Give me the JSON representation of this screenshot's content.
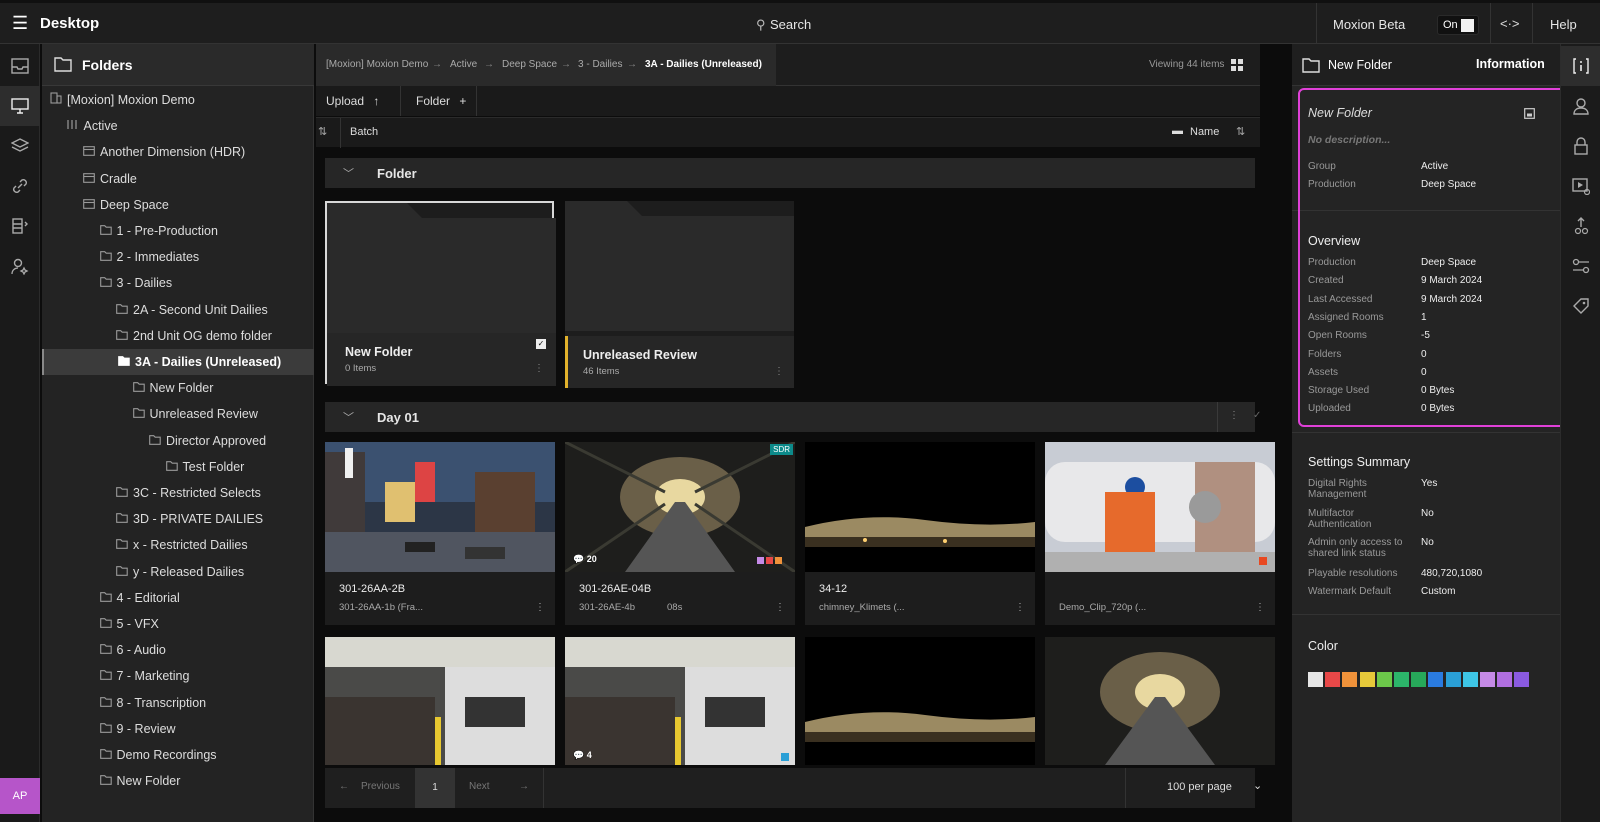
{
  "topbar": {
    "title": "Desktop",
    "search": "Search",
    "beta": "Moxion Beta",
    "toggle": "On",
    "help": "Help"
  },
  "tree": {
    "title": "Folders",
    "items": [
      {
        "label": "[Moxion] Moxion Demo",
        "level": 0,
        "icon": "building-icon"
      },
      {
        "label": "Active",
        "level": 1,
        "icon": "columns-icon"
      },
      {
        "label": "Another Dimension (HDR)",
        "level": 2,
        "icon": "production-icon"
      },
      {
        "label": "Cradle",
        "level": 2,
        "icon": "production-icon"
      },
      {
        "label": "Deep Space",
        "level": 2,
        "icon": "production-icon"
      },
      {
        "label": "1 - Pre-Production",
        "level": 3,
        "icon": "folder-icon"
      },
      {
        "label": "2 - Immediates",
        "level": 3,
        "icon": "folder-icon"
      },
      {
        "label": "3 - Dailies",
        "level": 3,
        "icon": "folder-icon"
      },
      {
        "label": "2A - Second Unit Dailies",
        "level": 4,
        "icon": "folder-icon"
      },
      {
        "label": "2nd Unit OG demo folder",
        "level": 4,
        "icon": "folder-icon"
      },
      {
        "label": "3A - Dailies (Unreleased)",
        "level": 4,
        "icon": "folder-icon",
        "selected": true
      },
      {
        "label": "New Folder",
        "level": 5,
        "icon": "folder-icon"
      },
      {
        "label": "Unreleased Review",
        "level": 5,
        "icon": "folder-icon"
      },
      {
        "label": "Director Approved",
        "level": 6,
        "icon": "folder-icon"
      },
      {
        "label": "Test Folder",
        "level": 7,
        "icon": "folder-icon"
      },
      {
        "label": "3C - Restricted Selects",
        "level": 4,
        "icon": "folder-icon"
      },
      {
        "label": "3D - PRIVATE DAILIES",
        "level": 4,
        "icon": "folder-icon"
      },
      {
        "label": "x - Restricted Dailies",
        "level": 4,
        "icon": "folder-icon"
      },
      {
        "label": "y - Released Dailies",
        "level": 4,
        "icon": "folder-icon"
      },
      {
        "label": "4 - Editorial",
        "level": 3,
        "icon": "folder-icon"
      },
      {
        "label": "5 - VFX",
        "level": 3,
        "icon": "folder-icon"
      },
      {
        "label": "6 - Audio",
        "level": 3,
        "icon": "folder-icon"
      },
      {
        "label": "7 - Marketing",
        "level": 3,
        "icon": "folder-icon"
      },
      {
        "label": "8 - Transcription",
        "level": 3,
        "icon": "folder-icon"
      },
      {
        "label": "9 - Review",
        "level": 3,
        "icon": "folder-icon"
      },
      {
        "label": "Demo Recordings",
        "level": 3,
        "icon": "folder-icon"
      },
      {
        "label": "New Folder",
        "level": 3,
        "icon": "folder-icon"
      }
    ],
    "avatar": "AP"
  },
  "main": {
    "breadcrumbs": [
      "[Moxion] Moxion Demo",
      "Active",
      "Deep Space",
      "3 - Dailies",
      "3A - Dailies (Unreleased)"
    ],
    "viewing": "Viewing 44 items",
    "upload": "Upload",
    "folder_btn": "Folder",
    "batch": "Batch",
    "sort": "Name",
    "folder_section": "Folder",
    "folders": [
      {
        "name": "New Folder",
        "count": "0 Items"
      },
      {
        "name": "Unreleased Review",
        "count": "46 Items"
      }
    ],
    "day_section": "Day 01",
    "assets": [
      {
        "name": "301-26AA-2B",
        "sub": "301-26AA-1b (Fra...",
        "dur": ""
      },
      {
        "name": "301-26AE-04B",
        "sub": "301-26AE-4b",
        "dur": "08s",
        "badge": "SDR",
        "comments": "20"
      },
      {
        "name": "34-12",
        "sub": "chimney_Klimets (...",
        "dur": ""
      },
      {
        "name": "",
        "sub": "Demo_Clip_720p (...",
        "dur": ""
      }
    ],
    "row2_comments": "4",
    "pager": {
      "prev": "Previous",
      "page": "1",
      "next": "Next",
      "per_page": "100 per page"
    }
  },
  "info": {
    "header": "New Folder",
    "tab": "Information",
    "name": "New Folder",
    "description": "No description...",
    "basic": [
      {
        "k": "Group",
        "v": "Active"
      },
      {
        "k": "Production",
        "v": "Deep Space"
      }
    ],
    "overview_title": "Overview",
    "overview": [
      {
        "k": "Production",
        "v": "Deep Space"
      },
      {
        "k": "Created",
        "v": "9 March 2024"
      },
      {
        "k": "Last Accessed",
        "v": "9 March 2024"
      },
      {
        "k": "Assigned Rooms",
        "v": "1"
      },
      {
        "k": "Open Rooms",
        "v": "-5"
      },
      {
        "k": "Folders",
        "v": "0"
      },
      {
        "k": "Assets",
        "v": "0"
      },
      {
        "k": "Storage Used",
        "v": "0 Bytes"
      },
      {
        "k": "Uploaded",
        "v": "0 Bytes"
      }
    ],
    "settings_title": "Settings Summary",
    "settings": [
      {
        "k": "Digital Rights Management",
        "v": "Yes"
      },
      {
        "k": "Multifactor Authentication",
        "v": "No"
      },
      {
        "k": "Admin only access to shared link status",
        "v": "No"
      },
      {
        "k": "Playable resolutions",
        "v": "480,720,1080"
      },
      {
        "k": "Watermark Default",
        "v": "Custom"
      }
    ],
    "color_title": "Color",
    "colors": [
      "#e6e6e6",
      "#e84848",
      "#f0923a",
      "#e6c93a",
      "#6cc84a",
      "#2cb56a",
      "#27a85a",
      "#2a7be0",
      "#2a9fd6",
      "#3ec6e6",
      "#c58ae6",
      "#b06ee0",
      "#8a5ae0"
    ]
  },
  "accents": {
    "highlight": "#e040d8",
    "avatar": "#b655c9",
    "folder_marker": "#e2b22c"
  }
}
